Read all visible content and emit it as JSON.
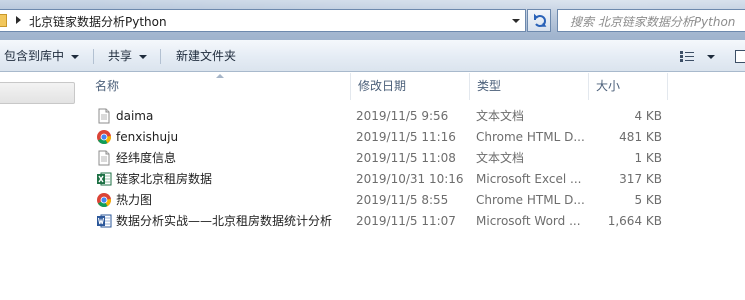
{
  "address_bar": {
    "path": "北京链家数据分析Python",
    "search_placeholder": "搜索 北京链家数据分析Python"
  },
  "toolbar": {
    "include_in_library": "包含到库中",
    "share": "共享",
    "new_folder": "新建文件夹"
  },
  "columns": {
    "name": "名称",
    "modified": "修改日期",
    "type": "类型",
    "size": "大小"
  },
  "files": [
    {
      "icon": "text-document-icon",
      "name": "daima",
      "modified": "2019/11/5 9:56",
      "type": "文本文档",
      "size": "4 KB"
    },
    {
      "icon": "chrome-icon",
      "name": "fenxishuju",
      "modified": "2019/11/5 11:16",
      "type": "Chrome HTML D...",
      "size": "481 KB"
    },
    {
      "icon": "text-document-icon",
      "name": "经纬度信息",
      "modified": "2019/11/5 11:08",
      "type": "文本文档",
      "size": "1 KB"
    },
    {
      "icon": "excel-icon",
      "name": "链家北京租房数据",
      "modified": "2019/10/31 10:16",
      "type": "Microsoft Excel ...",
      "size": "317 KB"
    },
    {
      "icon": "chrome-icon",
      "name": "热力图",
      "modified": "2019/11/5 8:55",
      "type": "Chrome HTML D...",
      "size": "5 KB"
    },
    {
      "icon": "word-icon",
      "name": "数据分析实战——北京租房数据统计分析",
      "modified": "2019/11/5 11:07",
      "type": "Microsoft Word ...",
      "size": "1,664 KB"
    }
  ],
  "colors": {
    "header_text": "#4c607a",
    "secondary_text": "#6d6d6d",
    "chrome_red": "#db4437",
    "chrome_green": "#0f9d58",
    "chrome_yellow": "#f4b400",
    "chrome_blue": "#4285f4",
    "excel_green": "#1e7145",
    "word_blue": "#2b579a"
  }
}
